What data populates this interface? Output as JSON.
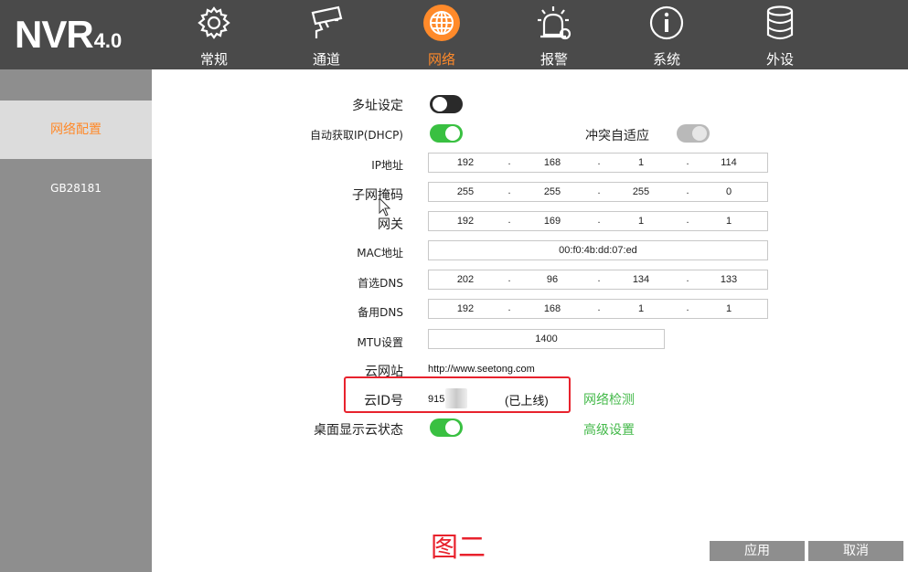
{
  "header": {
    "logo_main": "NVR",
    "logo_version": "4.0",
    "nav": [
      {
        "label": "常规",
        "icon": "gear-icon"
      },
      {
        "label": "通道",
        "icon": "camera-icon"
      },
      {
        "label": "网络",
        "icon": "globe-icon",
        "active": true
      },
      {
        "label": "报警",
        "icon": "alarm-icon"
      },
      {
        "label": "系统",
        "icon": "info-icon"
      },
      {
        "label": "外设",
        "icon": "database-icon"
      }
    ]
  },
  "sidebar": {
    "items": [
      {
        "label": "网络配置",
        "active": true
      },
      {
        "label": "GB28181"
      }
    ]
  },
  "form": {
    "multi_address": {
      "label": "多址设定",
      "state": "off"
    },
    "dhcp": {
      "label": "自动获取IP(DHCP)",
      "state": "on"
    },
    "conflict": {
      "label": "冲突自适应",
      "state": "disabled-on"
    },
    "ip": {
      "label": "IP地址",
      "octets": [
        "192",
        "168",
        "1",
        "114"
      ]
    },
    "subnet": {
      "label": "子网掩码",
      "octets": [
        "255",
        "255",
        "255",
        "0"
      ]
    },
    "gateway": {
      "label": "网关",
      "octets": [
        "192",
        "169",
        "1",
        "1"
      ]
    },
    "mac": {
      "label": "MAC地址",
      "value": "00:f0:4b:dd:07:ed"
    },
    "dns1": {
      "label": "首选DNS",
      "octets": [
        "202",
        "96",
        "134",
        "133"
      ]
    },
    "dns2": {
      "label": "备用DNS",
      "octets": [
        "192",
        "168",
        "1",
        "1"
      ]
    },
    "mtu": {
      "label": "MTU设置",
      "value": "1400"
    },
    "cloud_site": {
      "label": "云网站",
      "value": "http://www.seetong.com"
    },
    "cloud_id": {
      "label": "云ID号",
      "value": "915",
      "status": "(已上线)"
    },
    "desktop_cloud": {
      "label": "桌面显示云状态",
      "state": "on"
    },
    "network_test": "网络检测",
    "advanced": "高级设置",
    "octet_separator": "."
  },
  "figure_label": "图二",
  "buttons": {
    "apply": "应用",
    "cancel": "取消"
  },
  "colors": {
    "header_bg": "#4a4a4a",
    "sidebar_bg": "#8e8e8e",
    "accent_orange": "#ff8a2a",
    "toggle_on": "#39c041",
    "link_green": "#44b94a",
    "highlight_red": "#e8222d"
  }
}
